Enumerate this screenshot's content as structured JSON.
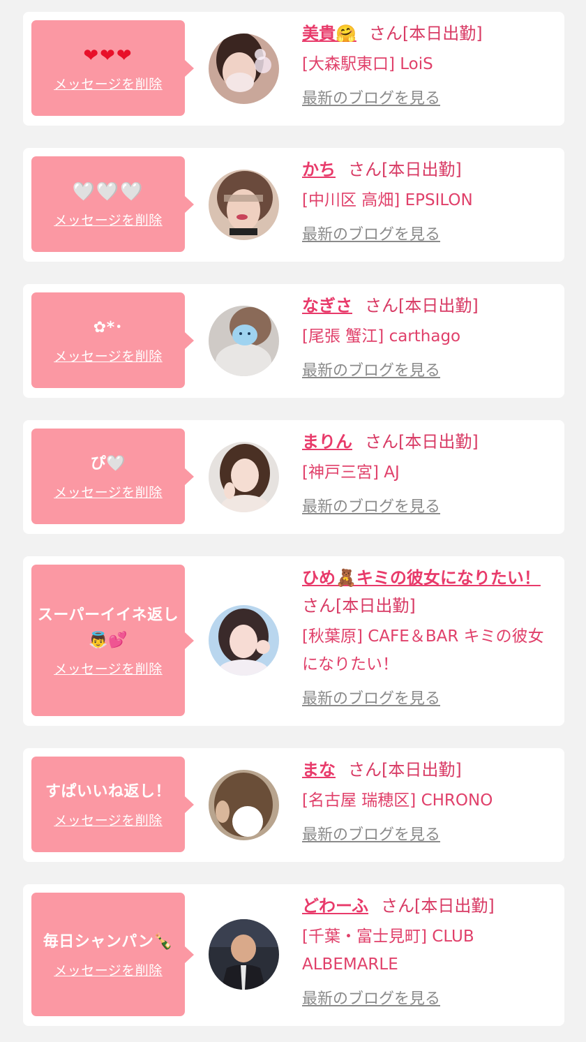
{
  "cards": [
    {
      "message": "❤❤❤",
      "delete_label": "メッセージを削除",
      "name": "美貴🤗",
      "suffix": "さん[本日出勤]",
      "shop": "[大森駅東口] LoiS",
      "blog_label": "最新のブログを見る"
    },
    {
      "message": "🤍🤍🤍",
      "delete_label": "メッセージを削除",
      "name": "かち",
      "suffix": "さん[本日出勤]",
      "shop": "[中川区 高畑] EPSILON",
      "blog_label": "最新のブログを見る"
    },
    {
      "message": "✿*･",
      "delete_label": "メッセージを削除",
      "name": "なぎさ",
      "suffix": "さん[本日出勤]",
      "shop": "[尾張 蟹江] carthago",
      "blog_label": "最新のブログを見る"
    },
    {
      "message": "ぴ🤍",
      "delete_label": "メッセージを削除",
      "name": "まりん",
      "suffix": "さん[本日出勤]",
      "shop": "[神戸三宮] AJ",
      "blog_label": "最新のブログを見る"
    },
    {
      "message": "スーパーイイネ返し👼💕",
      "delete_label": "メッセージを削除",
      "name": "ひめ🧸キミの彼女になりたい！",
      "suffix": "さん[本日出勤]",
      "shop": "[秋葉原] CAFE＆BAR キミの彼女になりたい！",
      "blog_label": "最新のブログを見る"
    },
    {
      "message": "すぱいいね返し！",
      "delete_label": "メッセージを削除",
      "name": "まな",
      "suffix": "さん[本日出勤]",
      "shop": "[名古屋 瑞穂区] CHRONO",
      "blog_label": "最新のブログを見る"
    },
    {
      "message": "毎日シャンパン🍾",
      "delete_label": "メッセージを削除",
      "name": "どわーふ",
      "suffix": "さん[本日出勤]",
      "shop": "[千葉・富士見町] CLUB ALBEMARLE",
      "blog_label": "最新のブログを見る"
    }
  ],
  "colors": {
    "background": "#f2f2f2",
    "card": "#ffffff",
    "bubble": "#fb98a3",
    "accent": "#e83a6a",
    "muted_link": "#8a8a8a"
  }
}
